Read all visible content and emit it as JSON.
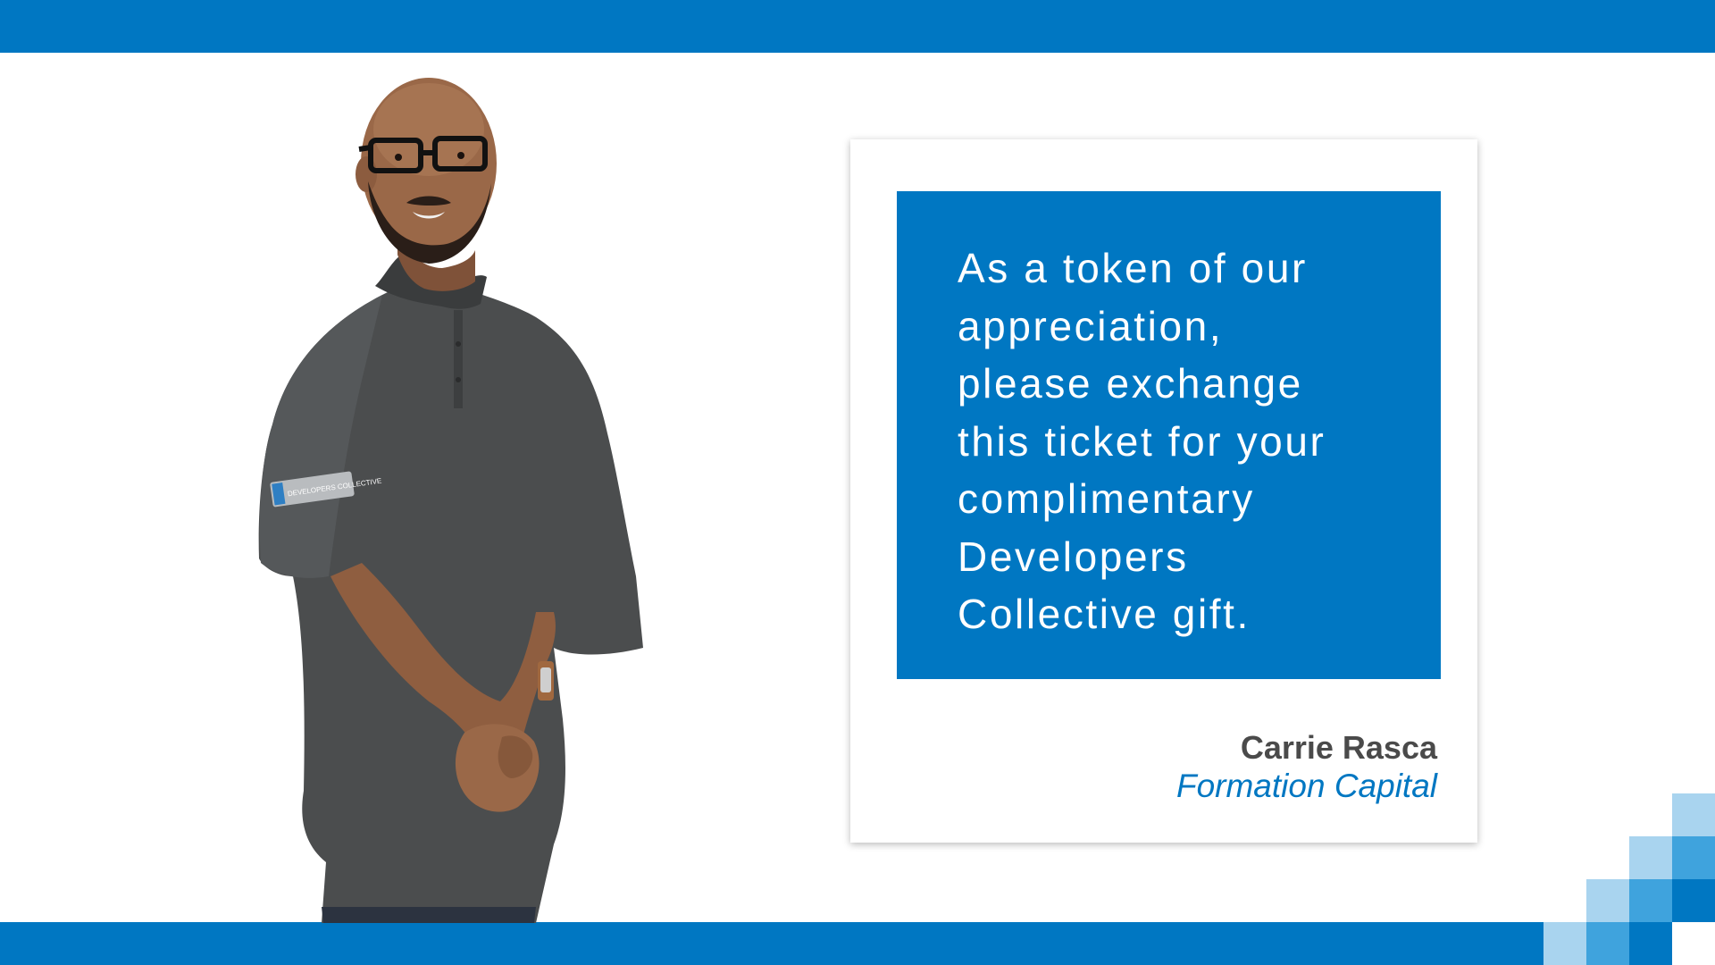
{
  "quote": {
    "text": "As a token of our\nappreciation,\nplease exchange\nthis ticket for your\ncomplimentary\nDevelopers\nCollective gift."
  },
  "attribution": {
    "name": "Carrie Rasca",
    "company": "Formation Capital"
  },
  "sleeve_patch": {
    "text": "DEVELOPERS COLLECTIVE"
  },
  "colors": {
    "brand_blue": "#0077c2",
    "name_gray": "#4a4a4a",
    "shirt_gray": "#4b4d4e",
    "skin": "#9a6848"
  }
}
